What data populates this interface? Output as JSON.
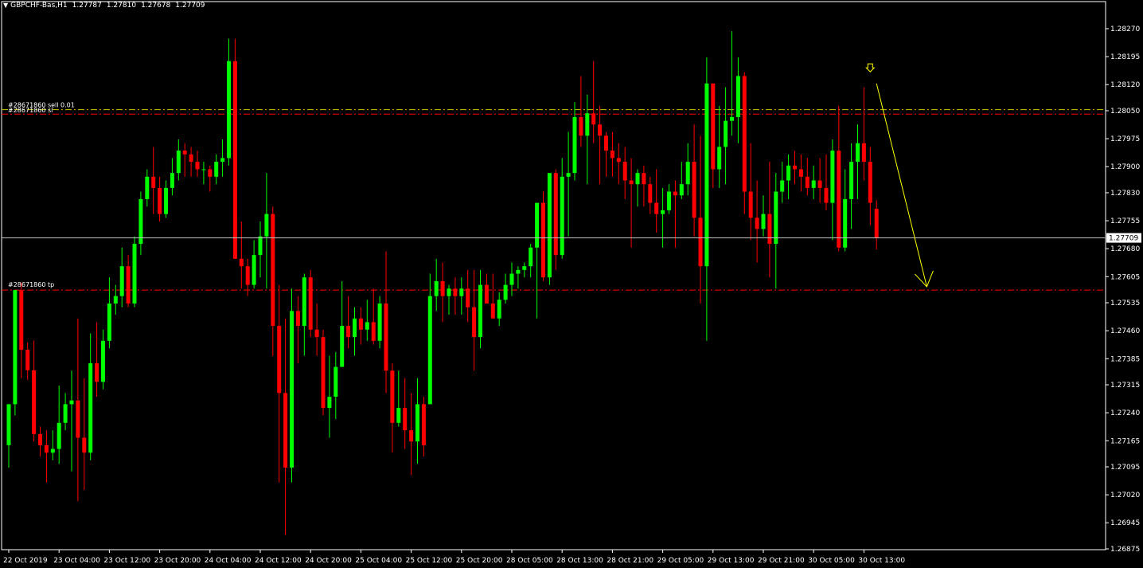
{
  "header": {
    "symbol": "GBPCHF-Bas,H1",
    "open": "1.27787",
    "high": "1.27810",
    "low": "1.27678",
    "close": "1.27709"
  },
  "colors": {
    "background": "#000000",
    "bull": "#00ff00",
    "bear": "#ff0000",
    "grid_border": "#ffffff",
    "order_line": "#ff0000",
    "order_line2": "#c8c800",
    "bid_line": "#c0c0c0",
    "arrow": "#ffff00"
  },
  "orders": {
    "entry_label": "#28671860 sell 0.01",
    "sl_label": "#28671860 sl",
    "tp_label": "#28671860 tp",
    "entry_price": 1.28053,
    "sl_price": 1.28041,
    "tp_price": 1.27569
  },
  "current_price_label": "1.27709",
  "chart_data": {
    "type": "candlestick",
    "symbol": "GBPCHF-Bas",
    "timeframe": "H1",
    "ylim": [
      1.26875,
      1.28345
    ],
    "y_ticks": [
      "1.28270",
      "1.28195",
      "1.28120",
      "1.28050",
      "1.27975",
      "1.27900",
      "1.27830",
      "1.27755",
      "1.27680",
      "1.27605",
      "1.27535",
      "1.27460",
      "1.27385",
      "1.27315",
      "1.27240",
      "1.27165",
      "1.27095",
      "1.27020",
      "1.26945",
      "1.26875"
    ],
    "x_tick_labels": [
      "22 Oct 2019",
      "23 Oct 04:00",
      "23 Oct 12:00",
      "23 Oct 20:00",
      "24 Oct 04:00",
      "24 Oct 12:00",
      "24 Oct 20:00",
      "25 Oct 04:00",
      "25 Oct 12:00",
      "25 Oct 20:00",
      "28 Oct 05:00",
      "28 Oct 13:00",
      "28 Oct 21:00",
      "29 Oct 05:00",
      "29 Oct 13:00",
      "29 Oct 21:00",
      "30 Oct 05:00",
      "30 Oct 13:00"
    ],
    "x_tick_bar_index": [
      0,
      8,
      16,
      24,
      32,
      40,
      48,
      56,
      64,
      72,
      80,
      88,
      96,
      104,
      112,
      120,
      128,
      136
    ],
    "ohlc": [
      [
        1.27153,
        1.27263,
        1.27093,
        1.27263
      ],
      [
        1.27263,
        1.27569,
        1.27233,
        1.27569
      ],
      [
        1.27569,
        1.27589,
        1.27333,
        1.27409
      ],
      [
        1.27409,
        1.27429,
        1.27328,
        1.27354
      ],
      [
        1.27354,
        1.27434,
        1.27163,
        1.27183
      ],
      [
        1.27183,
        1.27203,
        1.27123,
        1.27153
      ],
      [
        1.27153,
        1.27193,
        1.27053,
        1.27133
      ],
      [
        1.27133,
        1.27193,
        1.27113,
        1.27143
      ],
      [
        1.27143,
        1.27313,
        1.27103,
        1.27213
      ],
      [
        1.27213,
        1.27293,
        1.27193,
        1.27263
      ],
      [
        1.27263,
        1.27353,
        1.27083,
        1.27273
      ],
      [
        1.27273,
        1.27493,
        1.27003,
        1.27173
      ],
      [
        1.27173,
        1.27333,
        1.27033,
        1.27133
      ],
      [
        1.27133,
        1.27453,
        1.27113,
        1.27373
      ],
      [
        1.27373,
        1.27483,
        1.27283,
        1.27323
      ],
      [
        1.27323,
        1.27463,
        1.27303,
        1.27433
      ],
      [
        1.27433,
        1.27603,
        1.27413,
        1.27533
      ],
      [
        1.27533,
        1.27583,
        1.27503,
        1.27553
      ],
      [
        1.27553,
        1.27683,
        1.27523,
        1.27633
      ],
      [
        1.27633,
        1.27663,
        1.27523,
        1.27533
      ],
      [
        1.27533,
        1.27713,
        1.27523,
        1.27693
      ],
      [
        1.27693,
        1.27833,
        1.27663,
        1.27813
      ],
      [
        1.27813,
        1.27893,
        1.27793,
        1.27873
      ],
      [
        1.27873,
        1.27953,
        1.27773,
        1.27843
      ],
      [
        1.27843,
        1.27873,
        1.27753,
        1.27773
      ],
      [
        1.27773,
        1.27863,
        1.27763,
        1.27843
      ],
      [
        1.27843,
        1.27923,
        1.27823,
        1.27883
      ],
      [
        1.27883,
        1.27973,
        1.27863,
        1.27943
      ],
      [
        1.27943,
        1.27963,
        1.27873,
        1.27933
      ],
      [
        1.27933,
        1.27953,
        1.27873,
        1.27913
      ],
      [
        1.27913,
        1.27943,
        1.27873,
        1.27893
      ],
      [
        1.27893,
        1.27913,
        1.27853,
        1.27893
      ],
      [
        1.27893,
        1.27903,
        1.27833,
        1.27873
      ],
      [
        1.27873,
        1.27933,
        1.27853,
        1.27913
      ],
      [
        1.27913,
        1.27973,
        1.27873,
        1.27923
      ],
      [
        1.27923,
        1.28243,
        1.27903,
        1.28183
      ],
      [
        1.28183,
        1.28243,
        1.27653,
        1.27653
      ],
      [
        1.27653,
        1.27753,
        1.27573,
        1.27633
      ],
      [
        1.27633,
        1.27653,
        1.27553,
        1.27583
      ],
      [
        1.27583,
        1.27703,
        1.27573,
        1.27663
      ],
      [
        1.27663,
        1.27753,
        1.27603,
        1.27713
      ],
      [
        1.27713,
        1.27883,
        1.27573,
        1.27773
      ],
      [
        1.27773,
        1.27793,
        1.27393,
        1.27473
      ],
      [
        1.27473,
        1.27583,
        1.27053,
        1.27293
      ],
      [
        1.27293,
        1.27493,
        1.26913,
        1.27093
      ],
      [
        1.27093,
        1.27573,
        1.27053,
        1.27513
      ],
      [
        1.27513,
        1.27553,
        1.27373,
        1.27473
      ],
      [
        1.27473,
        1.27613,
        1.27393,
        1.27603
      ],
      [
        1.27603,
        1.27623,
        1.27443,
        1.27463
      ],
      [
        1.27463,
        1.27533,
        1.27393,
        1.27443
      ],
      [
        1.27443,
        1.27463,
        1.27233,
        1.27253
      ],
      [
        1.27253,
        1.27393,
        1.27173,
        1.27283
      ],
      [
        1.27283,
        1.27403,
        1.27223,
        1.27363
      ],
      [
        1.27363,
        1.27593,
        1.27363,
        1.27473
      ],
      [
        1.27473,
        1.27553,
        1.27413,
        1.27443
      ],
      [
        1.27443,
        1.27523,
        1.27393,
        1.27493
      ],
      [
        1.27493,
        1.27523,
        1.27423,
        1.27463
      ],
      [
        1.27463,
        1.27543,
        1.27433,
        1.27483
      ],
      [
        1.27483,
        1.27573,
        1.27423,
        1.27433
      ],
      [
        1.27433,
        1.27553,
        1.27413,
        1.27533
      ],
      [
        1.27533,
        1.27673,
        1.27293,
        1.27353
      ],
      [
        1.27353,
        1.27373,
        1.27133,
        1.27213
      ],
      [
        1.27213,
        1.27353,
        1.27203,
        1.27253
      ],
      [
        1.27253,
        1.27333,
        1.27143,
        1.27193
      ],
      [
        1.27193,
        1.27293,
        1.27073,
        1.27163
      ],
      [
        1.27163,
        1.27333,
        1.27103,
        1.27263
      ],
      [
        1.27263,
        1.27283,
        1.27123,
        1.27153
      ],
      [
        1.27263,
        1.27613,
        1.27263,
        1.27553
      ],
      [
        1.27553,
        1.27653,
        1.27513,
        1.27593
      ],
      [
        1.27593,
        1.27643,
        1.27483,
        1.27553
      ],
      [
        1.27553,
        1.27583,
        1.27503,
        1.27573
      ],
      [
        1.27573,
        1.27603,
        1.27503,
        1.27553
      ],
      [
        1.27553,
        1.27603,
        1.27503,
        1.27573
      ],
      [
        1.27573,
        1.27623,
        1.27483,
        1.27523
      ],
      [
        1.27523,
        1.27623,
        1.27353,
        1.27443
      ],
      [
        1.27443,
        1.27623,
        1.27413,
        1.27583
      ],
      [
        1.27583,
        1.27613,
        1.27533,
        1.27533
      ],
      [
        1.27533,
        1.27613,
        1.27493,
        1.27493
      ],
      [
        1.27493,
        1.27563,
        1.27473,
        1.27543
      ],
      [
        1.27543,
        1.27613,
        1.27533,
        1.27583
      ],
      [
        1.27583,
        1.27643,
        1.27553,
        1.27613
      ],
      [
        1.27613,
        1.27633,
        1.27573,
        1.27623
      ],
      [
        1.27623,
        1.27643,
        1.27603,
        1.27633
      ],
      [
        1.27633,
        1.27693,
        1.27603,
        1.27683
      ],
      [
        1.27683,
        1.27743,
        1.27493,
        1.27803
      ],
      [
        1.27803,
        1.27833,
        1.27593,
        1.27603
      ],
      [
        1.27603,
        1.27813,
        1.27583,
        1.27883
      ],
      [
        1.27883,
        1.27893,
        1.27623,
        1.27663
      ],
      [
        1.27663,
        1.27923,
        1.27653,
        1.27873
      ],
      [
        1.27873,
        1.27993,
        1.27713,
        1.27883
      ],
      [
        1.27883,
        1.28073,
        1.27863,
        1.28033
      ],
      [
        1.28033,
        1.28143,
        1.27953,
        1.27983
      ],
      [
        1.27983,
        1.28093,
        1.27853,
        1.28043
      ],
      [
        1.28043,
        1.28183,
        1.27963,
        1.28013
      ],
      [
        1.28013,
        1.28063,
        1.27853,
        1.27983
      ],
      [
        1.27983,
        1.27993,
        1.27873,
        1.27943
      ],
      [
        1.27943,
        1.27993,
        1.27873,
        1.27923
      ],
      [
        1.27923,
        1.27963,
        1.27853,
        1.27913
      ],
      [
        1.27913,
        1.27953,
        1.27813,
        1.27863
      ],
      [
        1.27863,
        1.27923,
        1.27683,
        1.27853
      ],
      [
        1.27853,
        1.27893,
        1.27793,
        1.27883
      ],
      [
        1.27883,
        1.27903,
        1.27793,
        1.27853
      ],
      [
        1.27853,
        1.27873,
        1.27773,
        1.27803
      ],
      [
        1.27803,
        1.27893,
        1.27723,
        1.27773
      ],
      [
        1.27773,
        1.27843,
        1.27683,
        1.27783
      ],
      [
        1.27783,
        1.27853,
        1.27773,
        1.27833
      ],
      [
        1.27833,
        1.27863,
        1.27683,
        1.27823
      ],
      [
        1.27823,
        1.27913,
        1.27813,
        1.27853
      ],
      [
        1.27853,
        1.27963,
        1.27823,
        1.27913
      ],
      [
        1.27913,
        1.28013,
        1.27713,
        1.27763
      ],
      [
        1.27763,
        1.27983,
        1.27533,
        1.27633
      ],
      [
        1.27633,
        1.28193,
        1.27433,
        1.28123
      ],
      [
        1.28123,
        1.28123,
        1.27843,
        1.27893
      ],
      [
        1.27893,
        1.28063,
        1.27843,
        1.27953
      ],
      [
        1.27953,
        1.28113,
        1.27853,
        1.28023
      ],
      [
        1.28023,
        1.28263,
        1.27983,
        1.28033
      ],
      [
        1.28033,
        1.28193,
        1.27963,
        1.28143
      ],
      [
        1.28143,
        1.28153,
        1.27773,
        1.27833
      ],
      [
        1.27833,
        1.27963,
        1.27703,
        1.27763
      ],
      [
        1.27763,
        1.27863,
        1.27643,
        1.27733
      ],
      [
        1.27733,
        1.27823,
        1.27713,
        1.27773
      ],
      [
        1.27773,
        1.27913,
        1.27603,
        1.27693
      ],
      [
        1.27693,
        1.27883,
        1.27573,
        1.27833
      ],
      [
        1.27833,
        1.27913,
        1.27803,
        1.27863
      ],
      [
        1.27863,
        1.27933,
        1.27813,
        1.27903
      ],
      [
        1.27903,
        1.27943,
        1.27853,
        1.27893
      ],
      [
        1.27893,
        1.27933,
        1.27833,
        1.27873
      ],
      [
        1.27873,
        1.27923,
        1.27823,
        1.27843
      ],
      [
        1.27843,
        1.27903,
        1.27813,
        1.27863
      ],
      [
        1.27863,
        1.27923,
        1.27803,
        1.27843
      ],
      [
        1.27843,
        1.27933,
        1.27783,
        1.27803
      ],
      [
        1.27803,
        1.27973,
        1.27703,
        1.27943
      ],
      [
        1.27943,
        1.28063,
        1.27673,
        1.27683
      ],
      [
        1.27683,
        1.27893,
        1.27673,
        1.27813
      ],
      [
        1.27813,
        1.27963,
        1.27733,
        1.27913
      ],
      [
        1.27913,
        1.28013,
        1.27813,
        1.27963
      ],
      [
        1.27963,
        1.28113,
        1.27863,
        1.27913
      ],
      [
        1.27913,
        1.27953,
        1.27743,
        1.27803
      ],
      [
        1.27787,
        1.2781,
        1.27678,
        1.27709
      ]
    ],
    "bid_price": 1.27709,
    "arrow": {
      "from_bar": 138,
      "from_price": 1.28123,
      "to_bar": 146,
      "to_price": 1.27578
    },
    "sell_marker": {
      "bar": 137,
      "price": 1.28165
    }
  }
}
